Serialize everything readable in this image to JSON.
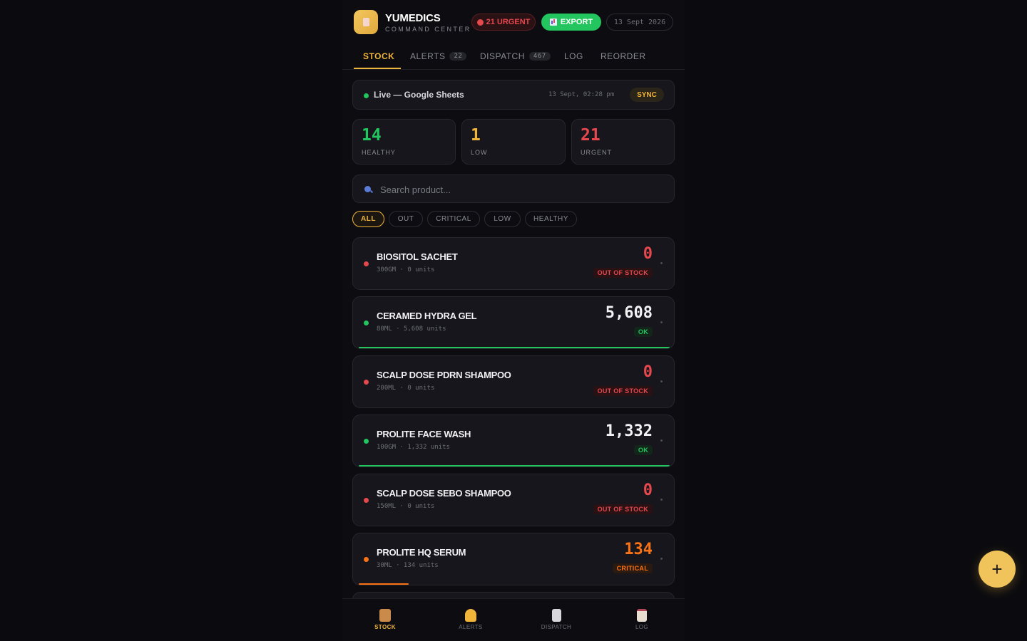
{
  "header": {
    "brand": "YUMEDICS",
    "subbrand": "COMMAND CENTER",
    "urgent_label": "21 URGENT",
    "export_label": "EXPORT",
    "date": "13 Sept 2026"
  },
  "tabs": [
    {
      "label": "STOCK",
      "count": null
    },
    {
      "label": "ALERTS",
      "count": "22"
    },
    {
      "label": "DISPATCH",
      "count": "467"
    },
    {
      "label": "LOG",
      "count": null
    },
    {
      "label": "REORDER",
      "count": null
    }
  ],
  "sync": {
    "label": "Live — Google Sheets",
    "time": "13 Sept, 02:28 pm",
    "button": "SYNC"
  },
  "stats": [
    {
      "value": "14",
      "label": "HEALTHY",
      "color": "#22c55e"
    },
    {
      "value": "1",
      "label": "LOW",
      "color": "#f0b43a"
    },
    {
      "value": "21",
      "label": "URGENT",
      "color": "#e5484d"
    }
  ],
  "search": {
    "placeholder": "Search product..."
  },
  "filters": [
    "ALL",
    "OUT",
    "CRITICAL",
    "LOW",
    "HEALTHY"
  ],
  "products": [
    {
      "name": "BIOSITOL SACHET",
      "meta": "300GM · 0 units",
      "qty": "0",
      "status": "OUT OF STOCK",
      "level": "out",
      "fill": 0
    },
    {
      "name": "CERAMED HYDRA GEL",
      "meta": "80ML · 5,608 units",
      "qty": "5,608",
      "status": "OK",
      "level": "ok",
      "fill": 1.0
    },
    {
      "name": "SCALP DOSE PDRN SHAMPOO",
      "meta": "200ML · 0 units",
      "qty": "0",
      "status": "OUT OF STOCK",
      "level": "out",
      "fill": 0
    },
    {
      "name": "PROLITE FACE WASH",
      "meta": "100GM · 1,332 units",
      "qty": "1,332",
      "status": "OK",
      "level": "ok",
      "fill": 1.0
    },
    {
      "name": "SCALP DOSE SEBO SHAMPOO",
      "meta": "150ML · 0 units",
      "qty": "0",
      "status": "OUT OF STOCK",
      "level": "out",
      "fill": 0
    },
    {
      "name": "PROLITE HQ SERUM",
      "meta": "30ML · 134 units",
      "qty": "134",
      "status": "CRITICAL",
      "level": "critical",
      "fill": 0.16
    }
  ],
  "colors": {
    "out": "#e5484d",
    "ok": "#22c55e",
    "critical": "#f97316",
    "accent": "#f0b43a"
  },
  "bottom_nav": [
    {
      "label": "STOCK",
      "icon": "package-icon"
    },
    {
      "label": "ALERTS",
      "icon": "bell-icon"
    },
    {
      "label": "DISPATCH",
      "icon": "receipt-icon"
    },
    {
      "label": "LOG",
      "icon": "clipboard-icon"
    }
  ],
  "fab_label": "+"
}
